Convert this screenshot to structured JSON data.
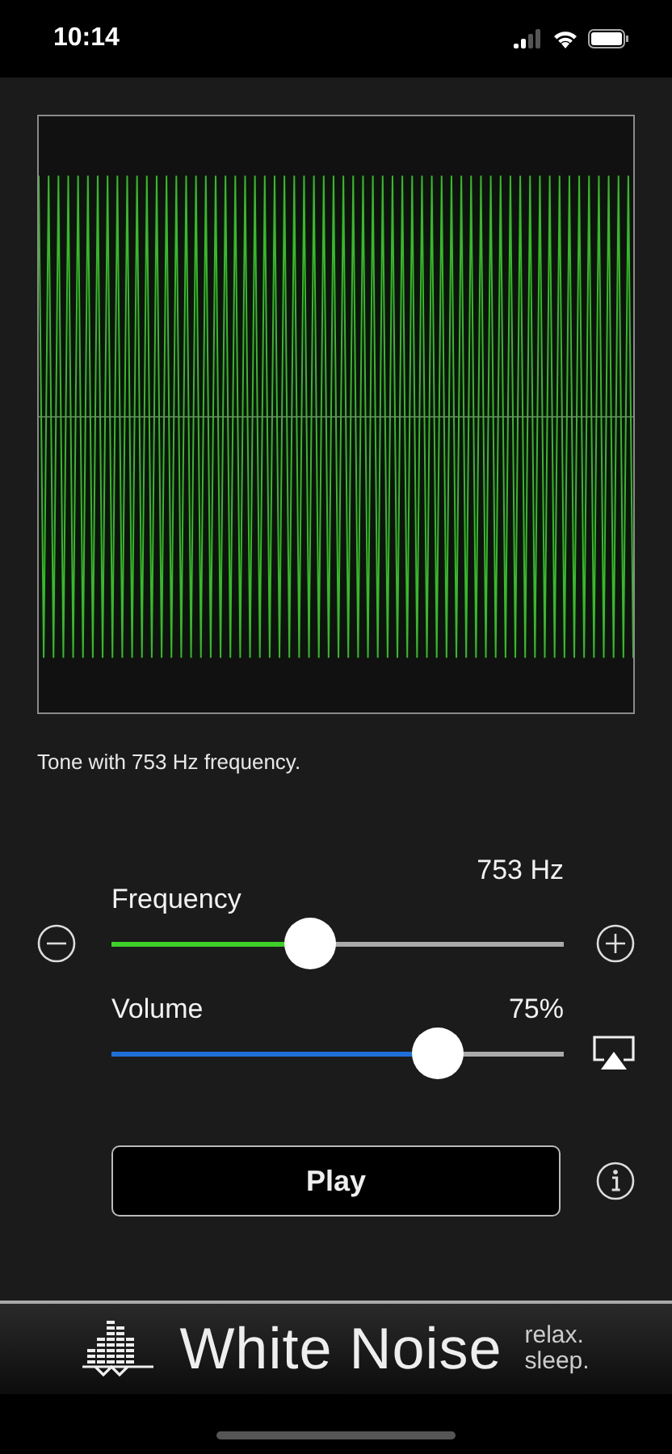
{
  "status_bar": {
    "time": "10:14"
  },
  "caption": "Tone with 753 Hz frequency.",
  "sliders": [
    {
      "kind": "stepper",
      "label": "Frequency",
      "reading": "753 Hz",
      "level": 0.44,
      "color": "#3fcf2a"
    },
    {
      "kind": "output",
      "label": "Volume",
      "reading": "75%",
      "level": 0.72,
      "color": "#1f6fd8"
    }
  ],
  "play_button": {
    "label": "Play"
  },
  "banner": {
    "title": "White Noise",
    "tagline_1": "relax.",
    "tagline_2": "sleep."
  }
}
